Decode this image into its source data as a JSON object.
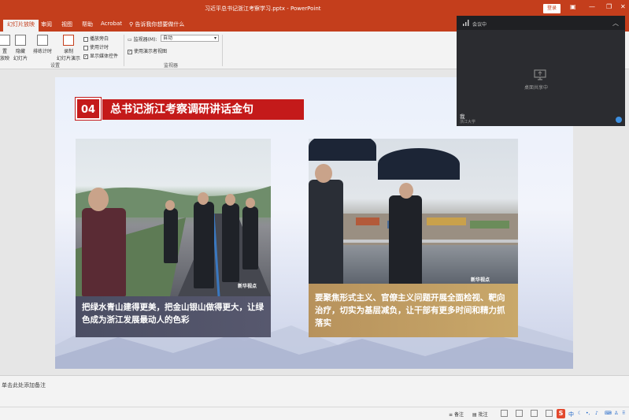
{
  "window": {
    "title": "习近平总书记浙江考察学习.pptx  -  PowerPoint",
    "login_label": "登录"
  },
  "ribbon_tabs": [
    "幻灯片放映",
    "审阅",
    "视图",
    "帮助",
    "Acrobat"
  ],
  "tell_me": "告诉我你想要做什么",
  "ribbon": {
    "buttons": [
      {
        "label": "置\n放映"
      },
      {
        "label": "隐藏\n幻灯片"
      },
      {
        "label": "排练计时"
      },
      {
        "label": "录制\n幻灯片演示"
      }
    ],
    "checks": [
      {
        "label": "播放旁白",
        "checked": false
      },
      {
        "label": "使用计时",
        "checked": false
      },
      {
        "label": "显示媒体控件",
        "checked": true
      }
    ],
    "group_settings": "设置",
    "monitor_label": "监视器(M):",
    "monitor_value": "自动",
    "presenter_view": "使用演示者视图",
    "group_monitor": "监视器"
  },
  "slide": {
    "section_number": "04",
    "section_title": "总书记浙江考察调研讲话金句",
    "caption_left": "把绿水青山建得更美，把金山银山做得更大，让绿色成为浙江发展最动人的色彩",
    "caption_right": "要聚焦形式主义、官僚主义问题开展全面检视、靶向治疗，切实为基层减负，让干部有更多时间和精力抓落实",
    "watermark": "新华视点"
  },
  "notes_placeholder": "单击此处添加备注",
  "status": {
    "notes_btn": "备注",
    "comments_btn": "批注"
  },
  "meeting": {
    "title": "会议中",
    "sharing_text": "桌面共享中",
    "user": "我",
    "org": "浙江大学"
  },
  "colors": {
    "accent": "#c43e1c",
    "slide_red": "#c41a1a",
    "caption_gold": "#c9a86a",
    "caption_slate": "#57586e"
  }
}
